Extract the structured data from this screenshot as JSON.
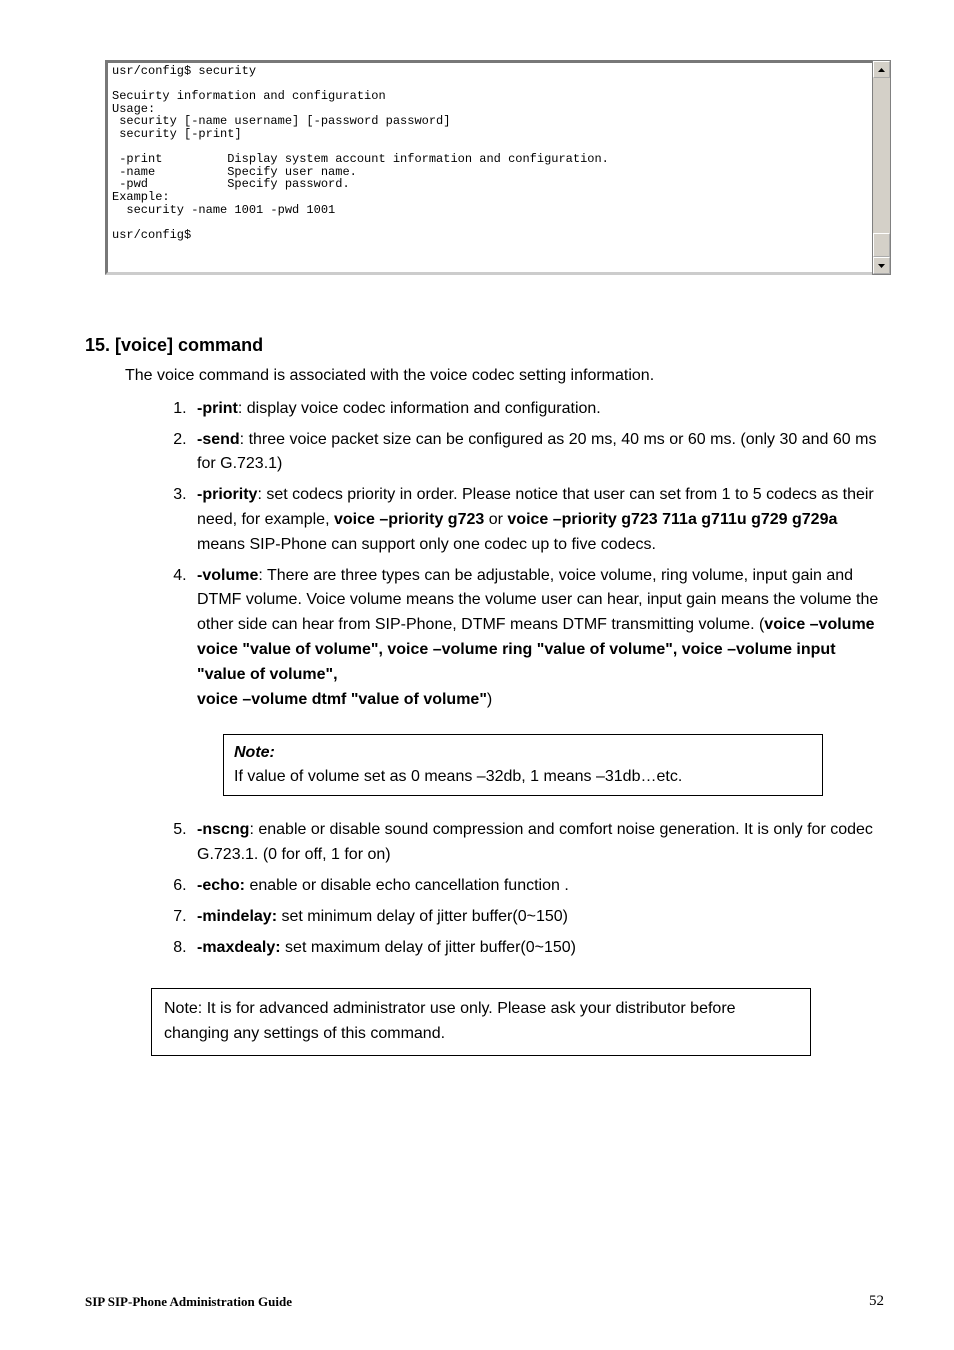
{
  "terminal": {
    "text": "usr/config$ security\n\nSecuirty information and configuration\nUsage:\n security [-name username] [-password password]\n security [-print]\n\n -print         Display system account information and configuration.\n -name          Specify user name.\n -pwd           Specify password.\nExample:\n  security -name 1001 -pwd 1001\n\nusr/config$"
  },
  "scrollbar": {
    "up_icon": "▲",
    "down_icon": "▼"
  },
  "heading": "15. [voice] command",
  "intro": "The voice command is associated with the voice codec setting information.",
  "items": [
    {
      "cmd": "-print",
      "sep": ": ",
      "desc": "display voice codec information and configuration."
    },
    {
      "cmd": "-send",
      "sep": ": ",
      "desc": "three voice packet size can be configured as 20 ms, 40 ms or 60 ms. (only 30 and 60 ms for G.723.1)"
    },
    {
      "cmd": "-priority",
      "sep": ": ",
      "desc_pre": "set codecs priority in order. Please notice that user can set from 1 to 5 codecs as their need, for example, ",
      "bold1": "voice –priority g723",
      "mid": " or ",
      "bold2": "voice –priority g723 711a g711u g729 g729a",
      "desc_post": " means SIP-Phone can support only one codec up to five codecs."
    },
    {
      "cmd": "-volume",
      "sep": ": ",
      "desc_pre": "There are three types can be adjustable, voice volume, ring volume, input gain and DTMF volume. Voice volume means the volume user can hear, input gain means the volume the other side can hear from SIP-Phone, DTMF means DTMF transmitting volume. (",
      "bold1": "voice –volume voice \"value of volume\", voice –volume ring \"value of volume\", voice –volume input \"value of volume\",",
      "break_before_bold2": true,
      "bold2": "voice –volume dtmf \"value of volume\"",
      "desc_post": ")"
    },
    {
      "cmd": "-nscng",
      "sep": ": ",
      "desc": "enable or disable sound compression and comfort noise generation. It is only for codec G.723.1. (0 for off, 1 for on)"
    },
    {
      "cmd": "-echo:",
      "sep": " ",
      "desc": "enable or disable echo cancellation function ."
    },
    {
      "cmd": "-mindelay:",
      "sep": " ",
      "desc": "set minimum delay of jitter buffer(0~150)"
    },
    {
      "cmd": "-maxdealy:",
      "sep": " ",
      "desc": "set maximum delay of jitter buffer(0~150)"
    }
  ],
  "note1": {
    "title": "Note:",
    "body": "If value of volume set as 0 means –32db, 1 means –31db…etc."
  },
  "note2": {
    "body": "Note: It is for advanced administrator use only. Please ask your distributor before changing any settings of this command."
  },
  "footer": {
    "left": "SIP SIP-Phone   Administration Guide",
    "right": "52"
  }
}
